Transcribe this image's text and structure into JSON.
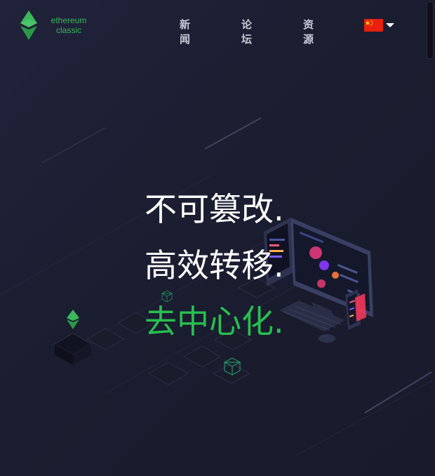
{
  "header": {
    "logo": {
      "line1": "ethereum",
      "line2": "classic",
      "icon": "etc-logo-icon"
    },
    "nav": [
      {
        "label": "新闻"
      },
      {
        "label": "论坛"
      },
      {
        "label": "资源"
      }
    ],
    "language": {
      "flag": "cn-flag-icon",
      "caret": "caret-down-icon"
    }
  },
  "hero": {
    "lines": [
      "不可篡改.",
      "高效转移.",
      "去中心化."
    ]
  },
  "colors": {
    "brand_green": "#3ab85a",
    "hero_accent": "#28c04f",
    "background": "#1c1e31",
    "flag_red": "#e8210f",
    "flag_star": "#ffde00"
  }
}
